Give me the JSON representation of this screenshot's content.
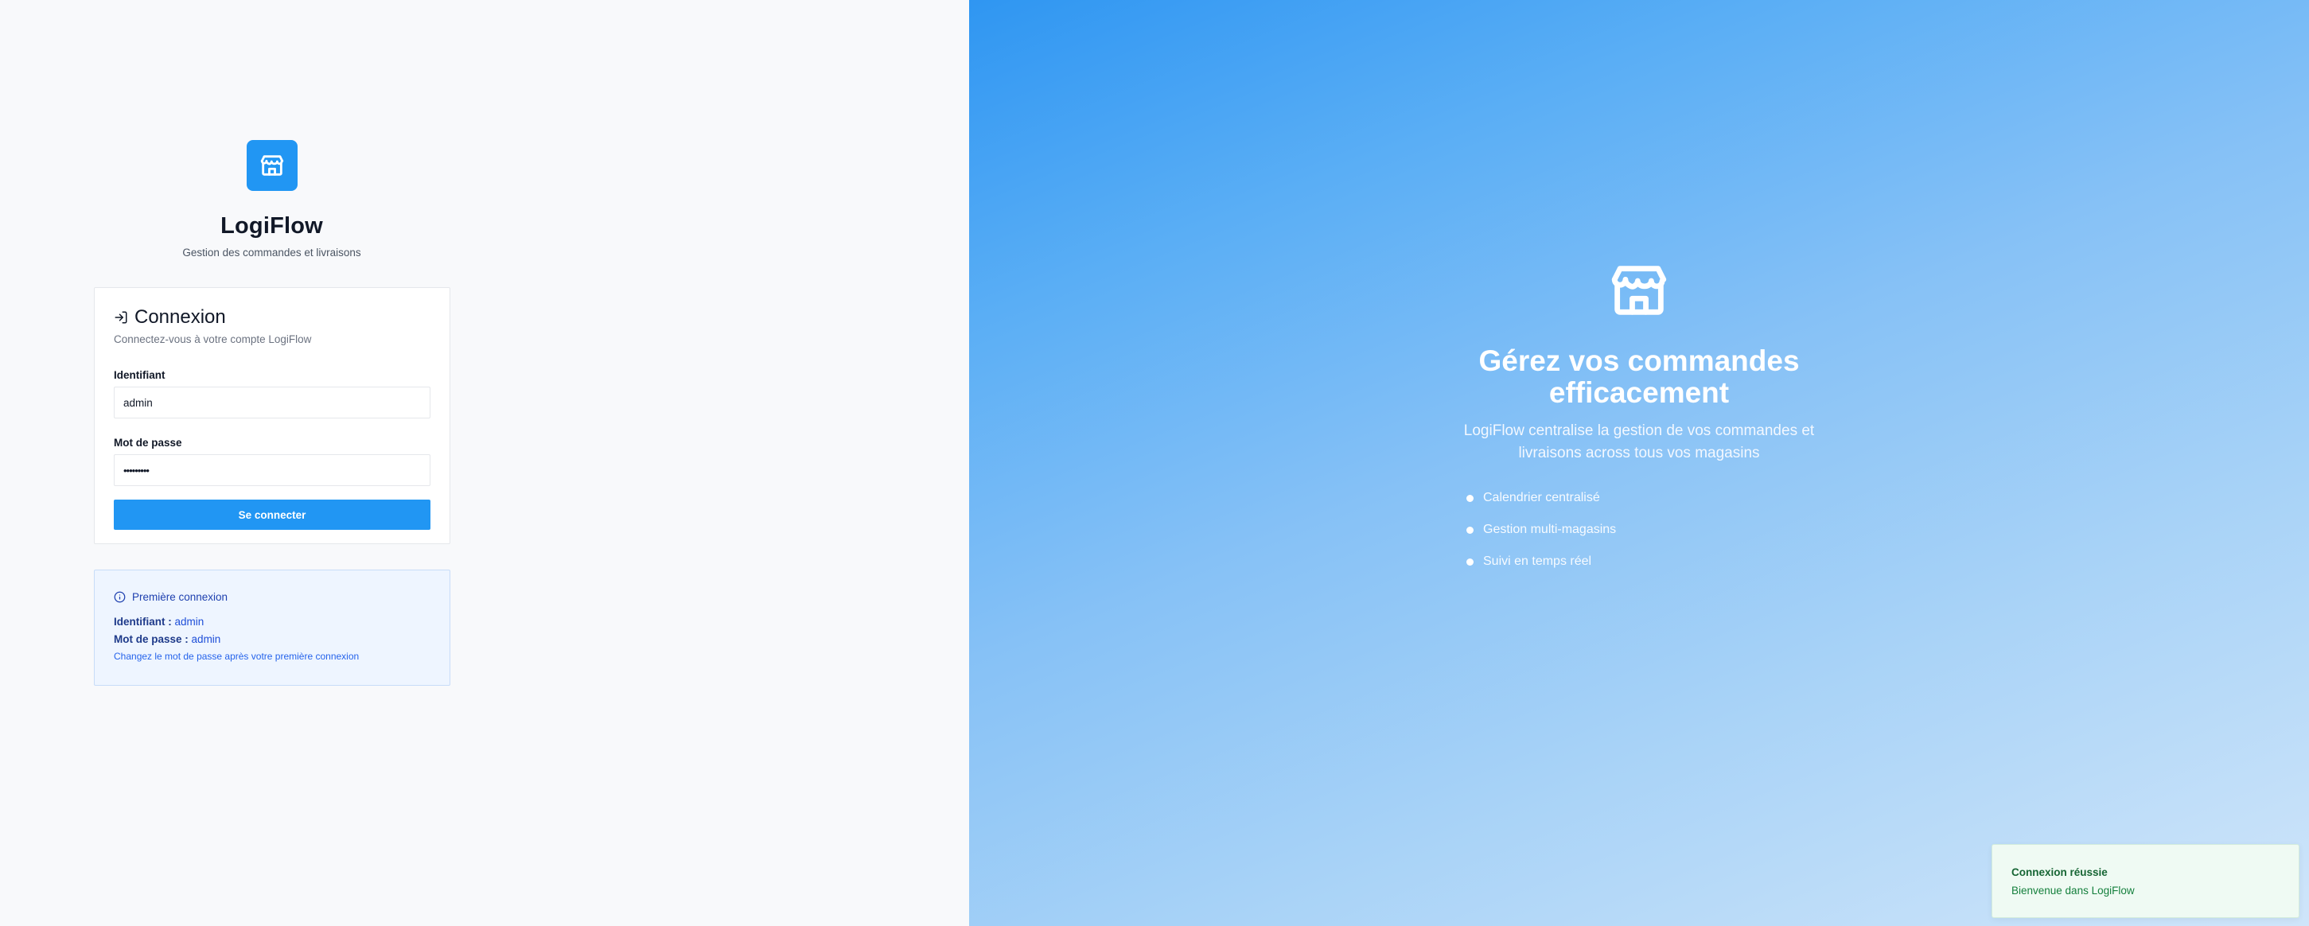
{
  "brand": {
    "app_name": "LogiFlow",
    "tagline": "Gestion des commandes et livraisons",
    "accent_color": "#2196f3",
    "logo_icon": "store-icon"
  },
  "login": {
    "title": "Connexion",
    "title_icon": "log-in-icon",
    "subtitle": "Connectez-vous à votre compte LogiFlow",
    "username_label": "Identifiant",
    "username_value": "admin",
    "password_label": "Mot de passe",
    "password_masked": "•••••••••",
    "submit_label": "Se connecter"
  },
  "first_login": {
    "icon": "info-icon",
    "title": "Première connexion",
    "username_key": "Identifiant :",
    "username_value": "admin",
    "password_key": "Mot de passe :",
    "password_value": "admin",
    "note": "Changez le mot de passe après votre première connexion"
  },
  "hero": {
    "icon": "store-icon",
    "title": "Gérez vos commandes efficacement",
    "description": "LogiFlow centralise la gestion de vos commandes et livraisons across tous vos magasins",
    "features": [
      "Calendrier centralisé",
      "Gestion multi-magasins",
      "Suivi en temps réel"
    ]
  },
  "toast": {
    "title": "Connexion réussie",
    "message": "Bienvenue dans LogiFlow",
    "status_color": "#166534"
  }
}
